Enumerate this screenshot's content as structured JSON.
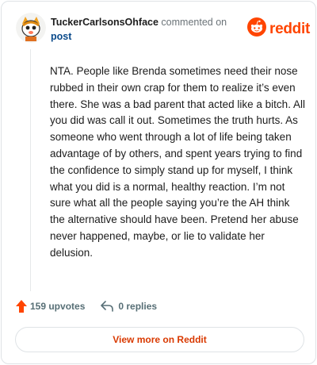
{
  "header": {
    "username": "TuckerCarlsonsOhface",
    "commented_text": "commented on",
    "post_link": "post"
  },
  "brand": {
    "name": "reddit",
    "icon": "reddit-alien-icon",
    "color": "#ff4500"
  },
  "comment": {
    "body": "NTA. People like Brenda sometimes need their nose rubbed in their own crap for them to realize it’s even there. She was a bad parent that acted like a bitch. All you did was call it out. Sometimes the truth hurts. As someone who went through a lot of life being taken advantage of by others, and spent years trying to find the confidence to simply stand up for myself, I think what you did is a normal, healthy reaction. I’m not sure what all the people saying you’re the AH think the alternative should have been. Pretend her abuse never happened, maybe, or lie to validate her delusion."
  },
  "footer": {
    "upvotes": "159 upvotes",
    "replies": "0 replies",
    "view_more": "View more on Reddit"
  },
  "colors": {
    "accent": "#ff4500",
    "link": "#0a4a8a",
    "muted": "#576f76"
  }
}
